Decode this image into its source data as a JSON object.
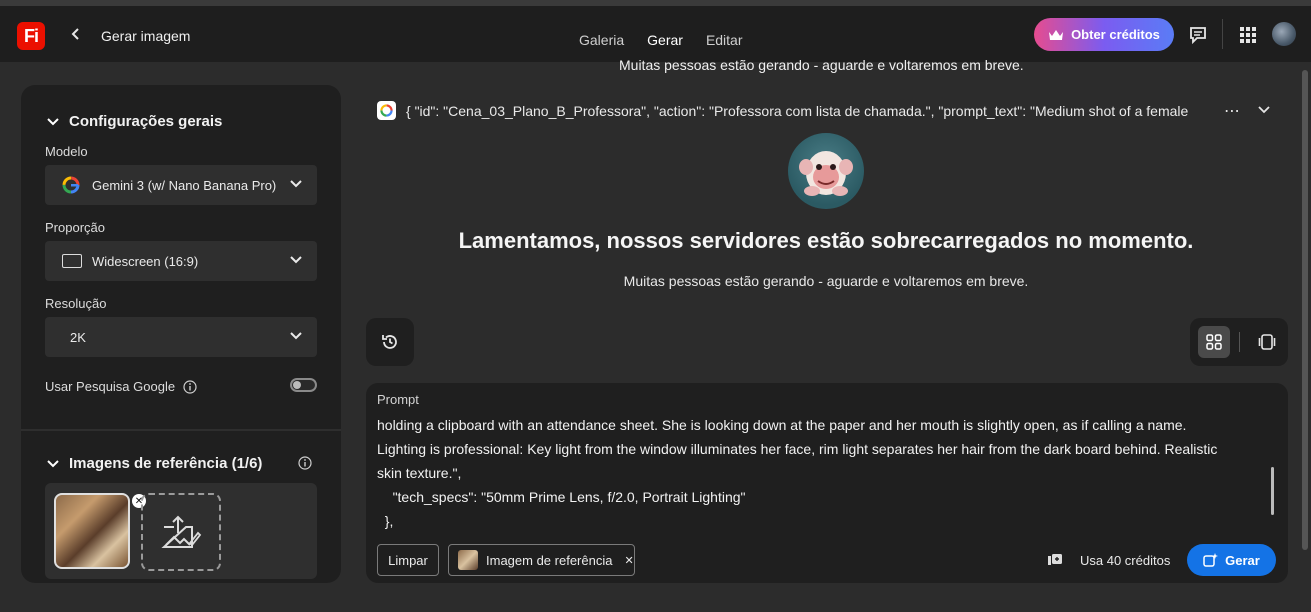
{
  "app": {
    "logo_text": "Fi",
    "page_title": "Gerar imagem",
    "brand_color": "#eb1000"
  },
  "nav": {
    "tabs": [
      {
        "label": "Galeria"
      },
      {
        "label": "Gerar",
        "active": true
      },
      {
        "label": "Editar"
      }
    ]
  },
  "header": {
    "credits_label": "Obter créditos"
  },
  "left_panel": {
    "general_settings_title": "Configurações gerais",
    "model_label": "Modelo",
    "model_value": "Gemini 3 (w/ Nano Banana Pro)",
    "ratio_label": "Proporção",
    "ratio_value": "Widescreen (16:9)",
    "resolution_label": "Resolução",
    "resolution_value": "2K",
    "google_search_label": "Usar Pesquisa Google",
    "google_search_enabled": false,
    "reference_title": "Imagens de referência (1/6)"
  },
  "main": {
    "top_cut_text": "Muitas pessoas estão gerando - aguarde e voltaremos em breve.",
    "prompt_summary": "{ \"id\": \"Cena_03_Plano_B_Professora\", \"action\": \"Professora com lista de chamada.\", \"prompt_text\": \"Medium shot of a female",
    "error_title": "Lamentamos, nossos servidores estão sobrecarregados no momento.",
    "error_subtitle": "Muitas pessoas estão gerando - aguarde e voltaremos em breve."
  },
  "prompt": {
    "label": "Prompt",
    "lines": [
      "holding a clipboard with an attendance sheet. She is looking down at the paper and her mouth is slightly open, as if calling a name.",
      "Lighting is professional: Key light from the window illuminates her face, rim light separates her hair from the dark board behind. Realistic",
      "skin texture.\",",
      "    \"tech_specs\": \"50mm Prime Lens, f/2.0, Portrait Lighting\"",
      "  },"
    ],
    "clear_label": "Limpar",
    "reference_chip_label": "Imagem de referência",
    "credits_text": "Usa 40 créditos",
    "generate_label": "Gerar"
  }
}
